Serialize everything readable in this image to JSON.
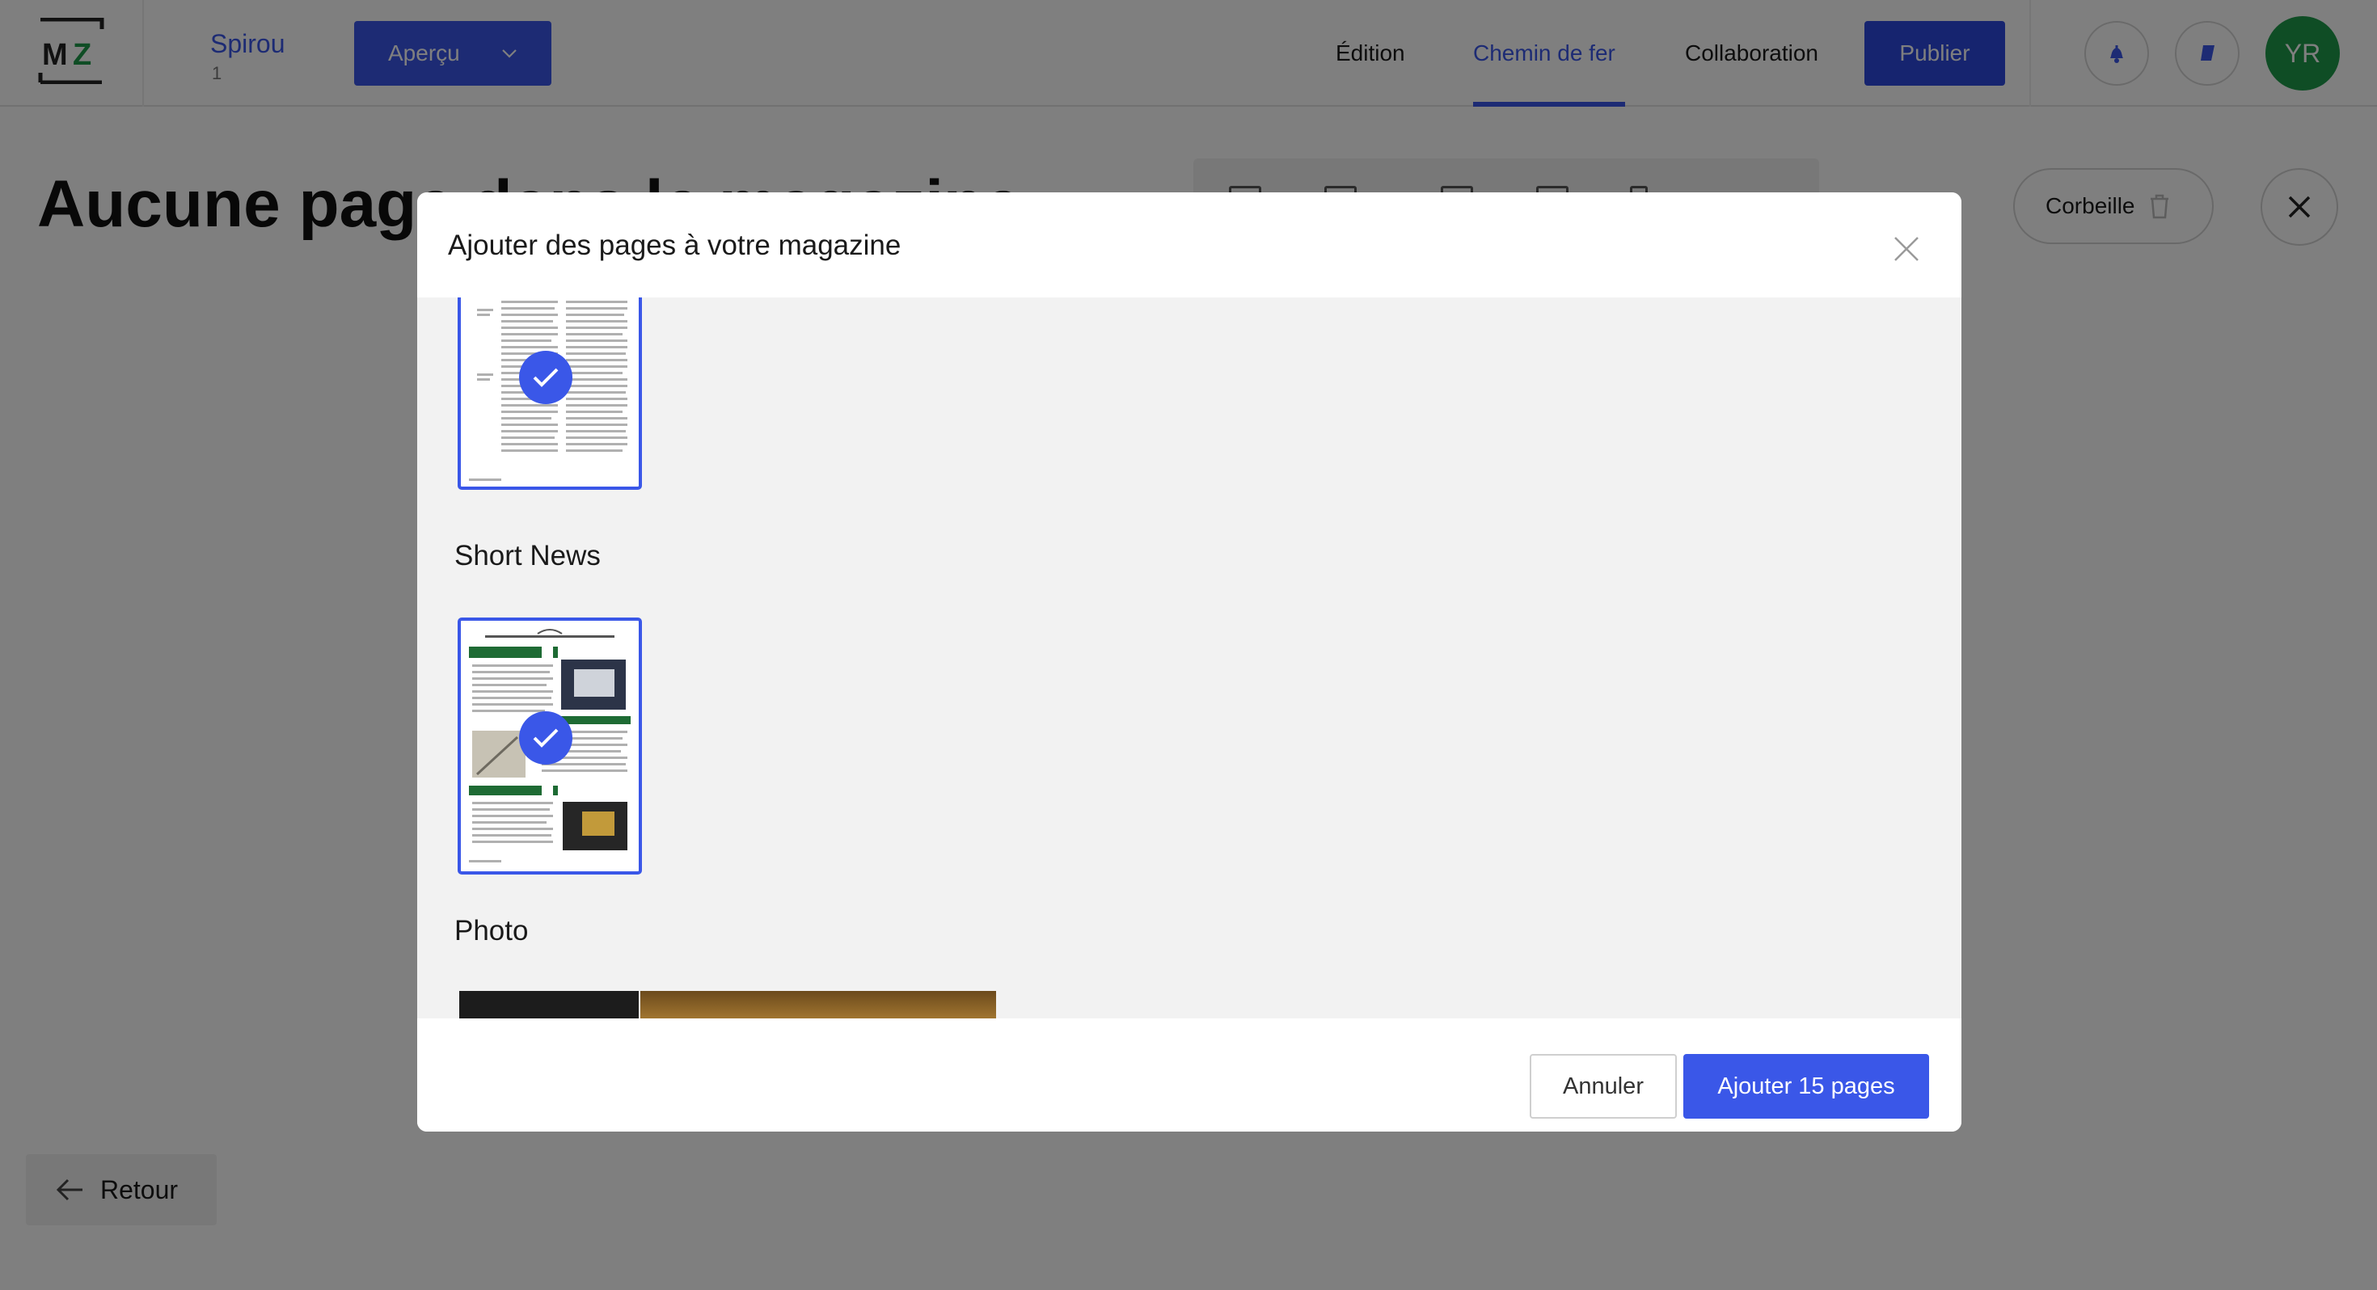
{
  "header": {
    "logo_text": "MZ",
    "project_title": "Spirou",
    "project_issue": "1",
    "apercu_label": "Aperçu",
    "nav": [
      {
        "label": "Édition"
      },
      {
        "label": "Chemin de fer"
      },
      {
        "label": "Collaboration"
      }
    ],
    "publish_label": "Publier",
    "avatar_initials": "YR",
    "colors": {
      "accent": "#3a57e8",
      "avatar": "#1f9a4a"
    }
  },
  "page": {
    "heading": "Aucune page dans le magazine",
    "trash_label": "Corbeille",
    "back_label": "Retour"
  },
  "modal": {
    "title": "Ajouter des pages à votre magazine",
    "sections": [
      {
        "title": "Short News"
      },
      {
        "title": "Photo"
      }
    ],
    "cancel_label": "Annuler",
    "submit_label": "Ajouter 15 pages"
  }
}
